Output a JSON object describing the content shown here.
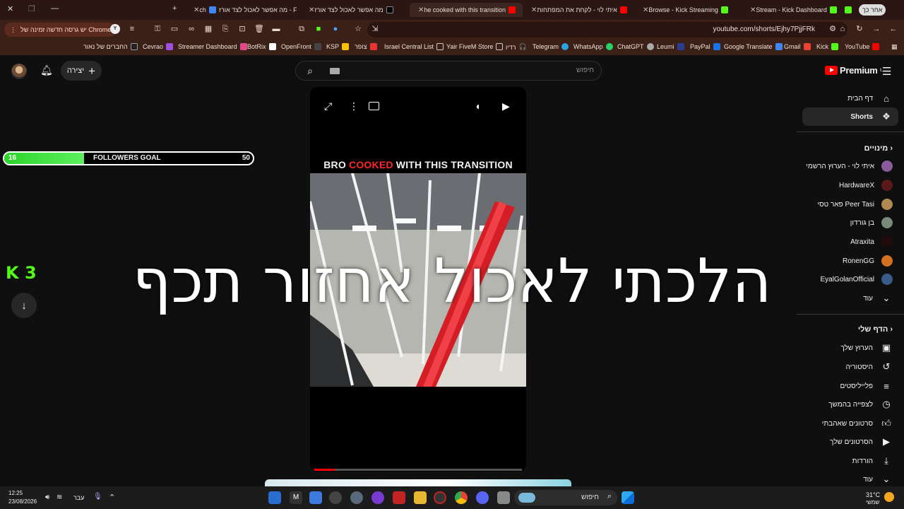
{
  "browser": {
    "tabs": [
      {
        "title": "ch",
        "color": "#888"
      },
      {
        "title": "מה אפשר לאכול לצד אורז - Find",
        "color": "#4285f4"
      },
      {
        "title": "מה אפשר לאכול לצד אורז",
        "color": "#111"
      },
      {
        "title": "he cooked with this transition",
        "color": "#f00"
      },
      {
        "title": "איתי לוי - לקחת את המפתחות",
        "color": "#f00"
      },
      {
        "title": "Browse - Kick Streaming",
        "color": "#53fc18"
      },
      {
        "title": "Stream - Kick Dashboard",
        "color": "#53fc18"
      }
    ],
    "profile_label": "אחר כך",
    "update_chip": "יש גרסה חדשה זמינה של Chrome",
    "url": "youtube.com/shorts/Ejhy7PjjFRk",
    "bookmarks": [
      "YouTube",
      "Kick",
      "Gmail",
      "Google Translate",
      "PayPal",
      "Leumi",
      "ChatGPT",
      "WhatsApp",
      "Telegram",
      "רדיו",
      "Yair FiveM Store",
      "Israel Central List",
      "צופר",
      "KSP",
      "OpenFront",
      "BotRix",
      "Streamer Dashboard",
      "Cevrao",
      "החברים של נאור"
    ]
  },
  "youtube": {
    "logo": "Premium",
    "logo_sup": "IL",
    "search_placeholder": "חיפוש",
    "create_label": "יצירה",
    "nav": [
      {
        "label": "דף הבית",
        "icon": "home-icon"
      },
      {
        "label": "Shorts",
        "icon": "shorts-icon"
      }
    ],
    "subs_header": "מינויים",
    "subs": [
      {
        "name": "איתי לוי - הערוץ הרשמי",
        "color": "#8a5a9a"
      },
      {
        "name": "HardwareX",
        "color": "#5a1a1a"
      },
      {
        "name": "פאר טסי Peer Tasi",
        "color": "#b08850"
      },
      {
        "name": "בן גורדון",
        "color": "#7a8a7a"
      },
      {
        "name": "Atraxita",
        "color": "#200a0a"
      },
      {
        "name": "RonenGG",
        "color": "#d07020"
      },
      {
        "name": "EyalGolanOfficial",
        "color": "#3a5a8a"
      }
    ],
    "subs_more": "עוד",
    "you_header": "הדף שלי",
    "you": [
      {
        "label": "הערוץ שלך",
        "icon": "channel-icon"
      },
      {
        "label": "היסטוריה",
        "icon": "history-icon"
      },
      {
        "label": "פלייליסטים",
        "icon": "playlist-icon"
      },
      {
        "label": "לצפייה בהמשך",
        "icon": "clock-icon"
      },
      {
        "label": "סרטונים שאהבתי",
        "icon": "like-icon"
      },
      {
        "label": "הסרטונים שלך",
        "icon": "video-icon"
      },
      {
        "label": "הורדות",
        "icon": "download-icon"
      },
      {
        "label": "עוד",
        "icon": "chevron-down-icon"
      }
    ],
    "short": {
      "title_pre": "BRO ",
      "title_red": "COOKED",
      "title_post": " WITH THIS TRANSITION",
      "progress": 0.1
    }
  },
  "stream_overlay": {
    "goal_current": "16",
    "goal_label": "FOLLOWERS GOAL",
    "goal_target": "50",
    "goal_fraction": 0.32,
    "kick_count": "3",
    "caption": "הלכתי לאכול אחזור תכף"
  },
  "taskbar": {
    "time": "12:25",
    "date": "23/08/2026",
    "lang": "עבר",
    "search": "חיפוש",
    "weather_temp": "31°C",
    "weather_desc": "שמשי"
  }
}
